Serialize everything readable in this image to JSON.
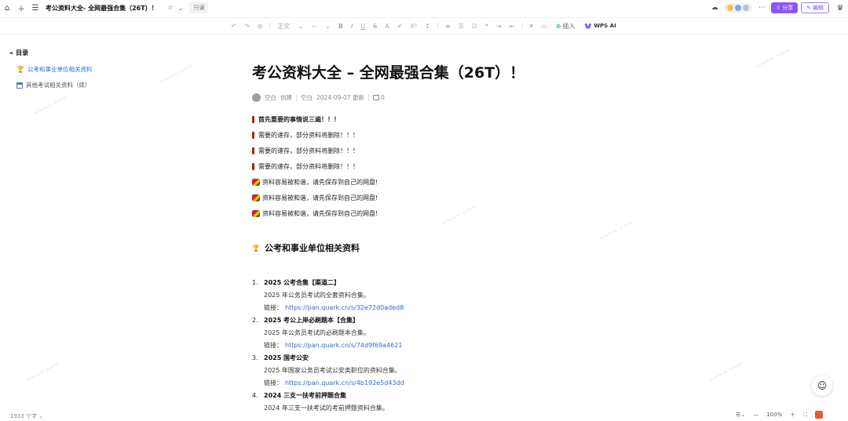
{
  "tabbar": {
    "doc_title": "考公资料大全- 全网最强合集（26T）！",
    "saved_label": "只读"
  },
  "topright": {
    "share_label": "分享",
    "edit_label": "编辑"
  },
  "toolbar": {
    "font_style": "正文",
    "font_size": "—",
    "insert_label": "插入",
    "wps_ai_label": "WPS AI"
  },
  "toc": {
    "title": "目录",
    "items": [
      {
        "label": "公考和事业单位相关资料",
        "icon": "trophy-icon"
      },
      {
        "label": "其他考试相关资料（续）",
        "icon": "calendar-icon"
      }
    ]
  },
  "doc": {
    "title": "考公资料大全 – 全网最强合集（26T）！",
    "meta": {
      "author": "空白",
      "created": "创建",
      "updater": "空白",
      "updated": "2024-09-07 更新",
      "comments": "0"
    },
    "notices": [
      {
        "text": "首先重要的事情说三遍！！！",
        "kind": "exclaim",
        "bold": true
      },
      {
        "text": "需要的速存，部分资料将删除！！！",
        "kind": "exclaim"
      },
      {
        "text": "需要的速存，部分资料将删除！！！",
        "kind": "exclaim"
      },
      {
        "text": "需要的速存，部分资料将删除！！！",
        "kind": "exclaim"
      },
      {
        "text": "资料容易被和谐，请先保存到自己的网盘!",
        "kind": "warn"
      },
      {
        "text": "资料容易被和谐，请先保存到自己的网盘!",
        "kind": "warn"
      },
      {
        "text": "资料容易被和谐，请先保存到自己的网盘!",
        "kind": "warn"
      }
    ],
    "section_heading": "公考和事业单位相关资料",
    "list": [
      {
        "num": "1.",
        "title": "2025 公考合集【渠道二】",
        "desc": "2025 年公务员考试的全套资料合集。",
        "link_label": "链接：",
        "url": "https://pan.quark.cn/s/32e72d0aded8"
      },
      {
        "num": "2.",
        "title": "2025 考公上岸必刷题本【合集】",
        "desc": "2025 年公务员考试的必刷题本合集。",
        "link_label": "链接：",
        "url": "https://pan.quark.cn/s/74d9f69a4621"
      },
      {
        "num": "3.",
        "title": "2025 国考公安",
        "desc": "2025 年国家公务员考试公安类职位的资料合集。",
        "link_label": "链接：",
        "url": "https://pan.quark.cn/s/4b192e5d43dd"
      },
      {
        "num": "4.",
        "title": "2024 三支一扶考前押题合集",
        "desc": "2024 年三支一扶考试的考前押题资料合集。"
      }
    ]
  },
  "status": {
    "word_count": "1933 个字",
    "zoom": "100%"
  }
}
